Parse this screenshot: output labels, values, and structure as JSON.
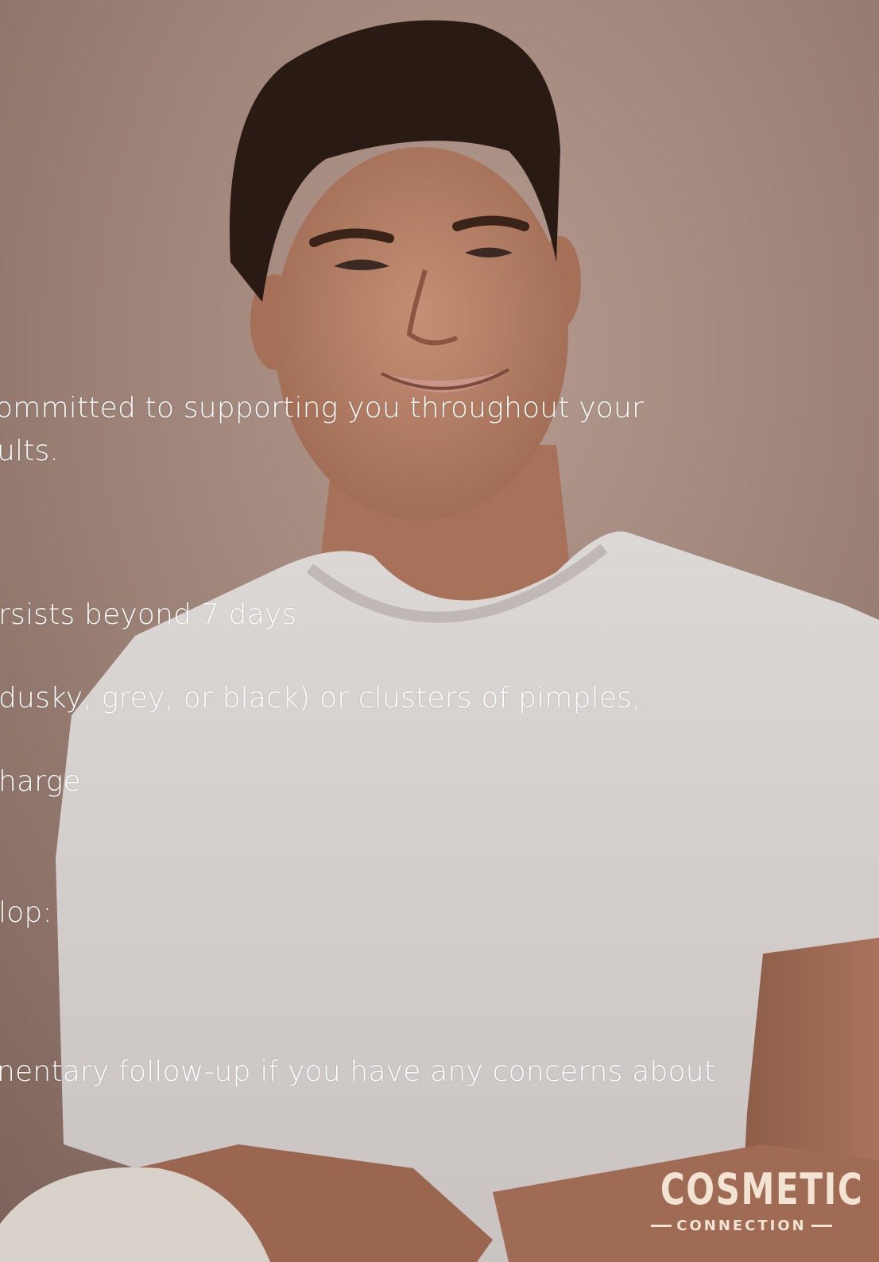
{
  "overlay_text": {
    "line1": "ommitted to supporting you throughout your",
    "line2": "ults.",
    "line3": "rsists beyond 7 days",
    "line4": "dusky, grey, or black) or clusters of pimples,",
    "line5": "harge",
    "line6": "lop:",
    "line7": "nentary follow-up if you have any concerns about"
  },
  "logo": {
    "main": "COSMETIC",
    "sub": "CONNECTION"
  },
  "colors": {
    "background": "#9d8278",
    "text": "#ffffff",
    "logo": "#f2e3d3",
    "shirt": "#d8d3d0",
    "hair": "#2a1a14"
  }
}
